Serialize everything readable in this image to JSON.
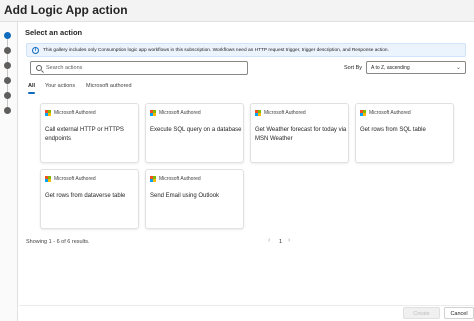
{
  "header": {
    "title": "Add Logic App action"
  },
  "stepper": {
    "step_count": 6,
    "active_step": 1
  },
  "main": {
    "section_title": "Select an action",
    "info_message": "This gallery includes only Consumption logic app workflows in this subscription. Workflows need an HTTP request trigger, trigger description, and Response action.",
    "search": {
      "placeholder": "Search actions",
      "value": ""
    },
    "sort": {
      "label": "Sort By",
      "selected": "A to Z, ascending"
    },
    "tabs": [
      {
        "label": "All",
        "active": true
      },
      {
        "label": "Your actions",
        "active": false
      },
      {
        "label": "Microsoft authored",
        "active": false
      }
    ],
    "cards": [
      {
        "publisher": "Microsoft Authored",
        "title": "Call external HTTP or HTTPS endpoints"
      },
      {
        "publisher": "Microsoft Authored",
        "title": "Execute SQL query on a database"
      },
      {
        "publisher": "Microsoft Authored",
        "title": "Get Weather forecast for today via MSN Weather"
      },
      {
        "publisher": "Microsoft Authored",
        "title": "Get rows from SQL table"
      },
      {
        "publisher": "Microsoft Authored",
        "title": "Get rows from dataverse table"
      },
      {
        "publisher": "Microsoft Authored",
        "title": "Send Email using Outlook"
      }
    ],
    "results_text": "Showing 1 - 6 of 6 results.",
    "pagination": {
      "current_page": "1"
    }
  },
  "footer": {
    "create_label": "Create",
    "cancel_label": "Cancel"
  },
  "colors": {
    "accent": "#0f6cbd",
    "info_bg": "#ebf3fc",
    "border": "#e1e1e1"
  }
}
